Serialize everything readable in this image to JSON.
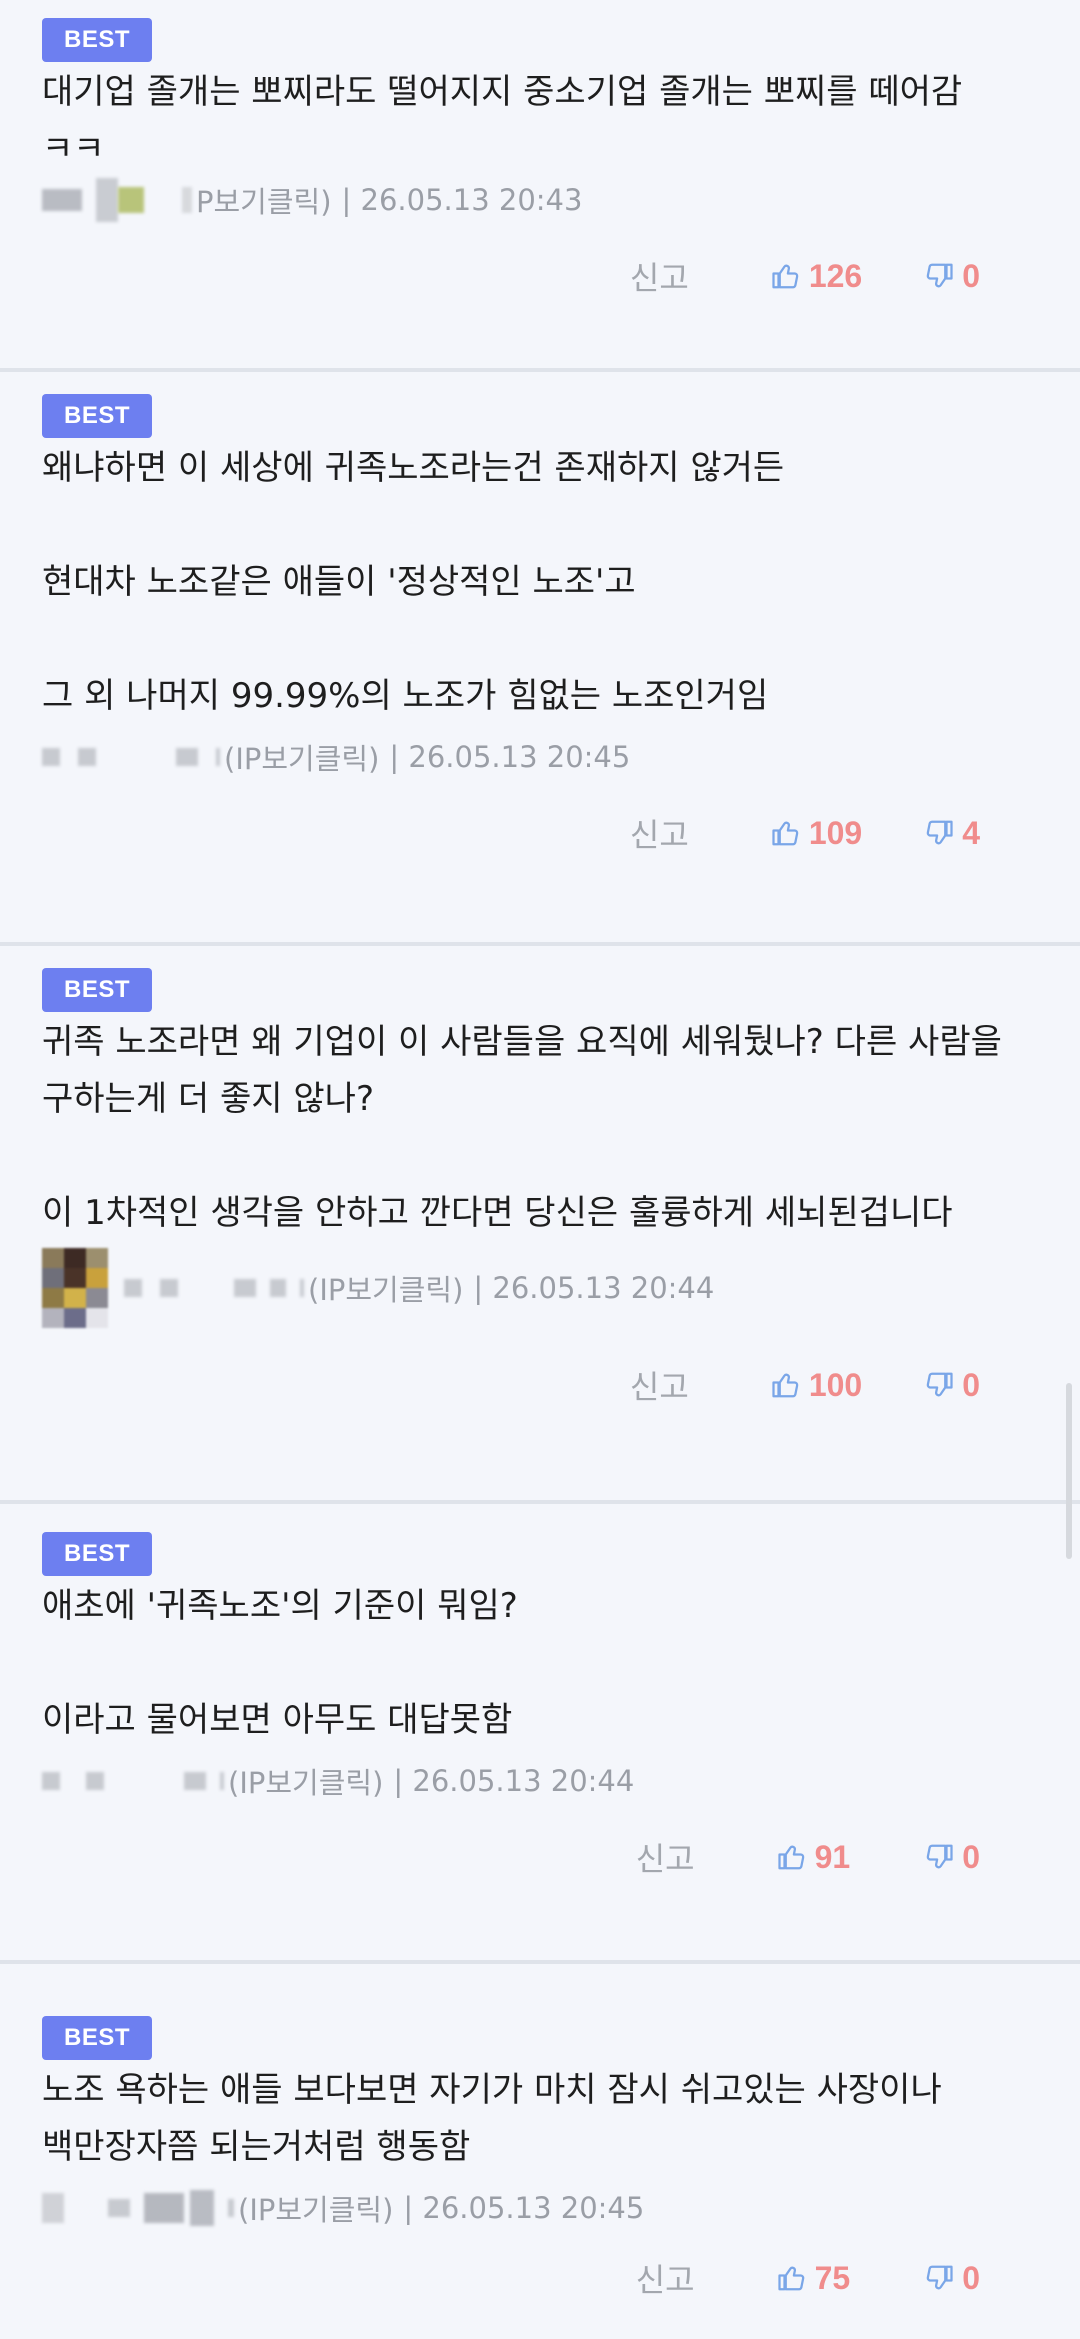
{
  "comments": [
    {
      "badge": "BEST",
      "text": "대기업 졸개는 뽀찌라도 떨어지지 중소기업 졸개는 뽀찌를 떼어감\nㅋㅋ",
      "ip_label": "P보기클릭)",
      "date": "| 26.05.13 20:43",
      "report": "신고",
      "likes": "126",
      "dislikes": "0"
    },
    {
      "badge": "BEST",
      "text": "왜냐하면 이 세상에 귀족노조라는건 존재하지 않거든\n\n현대차 노조같은 애들이 '정상적인 노조'고\n\n그 외 나머지 99.99%의 노조가 힘없는 노조인거임",
      "ip_label": "(IP보기클릭)",
      "date": "| 26.05.13 20:45",
      "report": "신고",
      "likes": "109",
      "dislikes": "4"
    },
    {
      "badge": "BEST",
      "text": "귀족 노조라면 왜 기업이 이 사람들을 요직에 세워뒀나? 다른 사람을 구하는게 더 좋지 않나?\n\n이 1차적인 생각을 안하고 깐다면 당신은 훌륭하게 세뇌된겁니다",
      "ip_label": "(IP보기클릭)",
      "date": "| 26.05.13 20:44",
      "report": "신고",
      "likes": "100",
      "dislikes": "0"
    },
    {
      "badge": "BEST",
      "text": "애초에 '귀족노조'의 기준이 뭐임?\n\n이라고 물어보면 아무도 대답못함",
      "ip_label": "(IP보기클릭)",
      "date": "| 26.05.13 20:44",
      "report": "신고",
      "likes": "91",
      "dislikes": "0"
    },
    {
      "badge": "BEST",
      "text": "노조 욕하는 애들 보다보면 자기가 마치 잠시 쉬고있는 사장이나 백만장자쯤 되는거처럼 행동함",
      "ip_label": "(IP보기클릭)",
      "date": "| 26.05.13 20:45",
      "report": "신고",
      "likes": "75",
      "dislikes": "0"
    }
  ],
  "colors": {
    "badge": "#6d7ff0",
    "like_icon": "#7aa6e8",
    "vote_count": "#f08c8c",
    "meta": "#9a9ea6",
    "background": "#f4f6fb"
  },
  "icons": {
    "like": "thumbs-up-icon",
    "dislike": "thumbs-down-icon"
  }
}
